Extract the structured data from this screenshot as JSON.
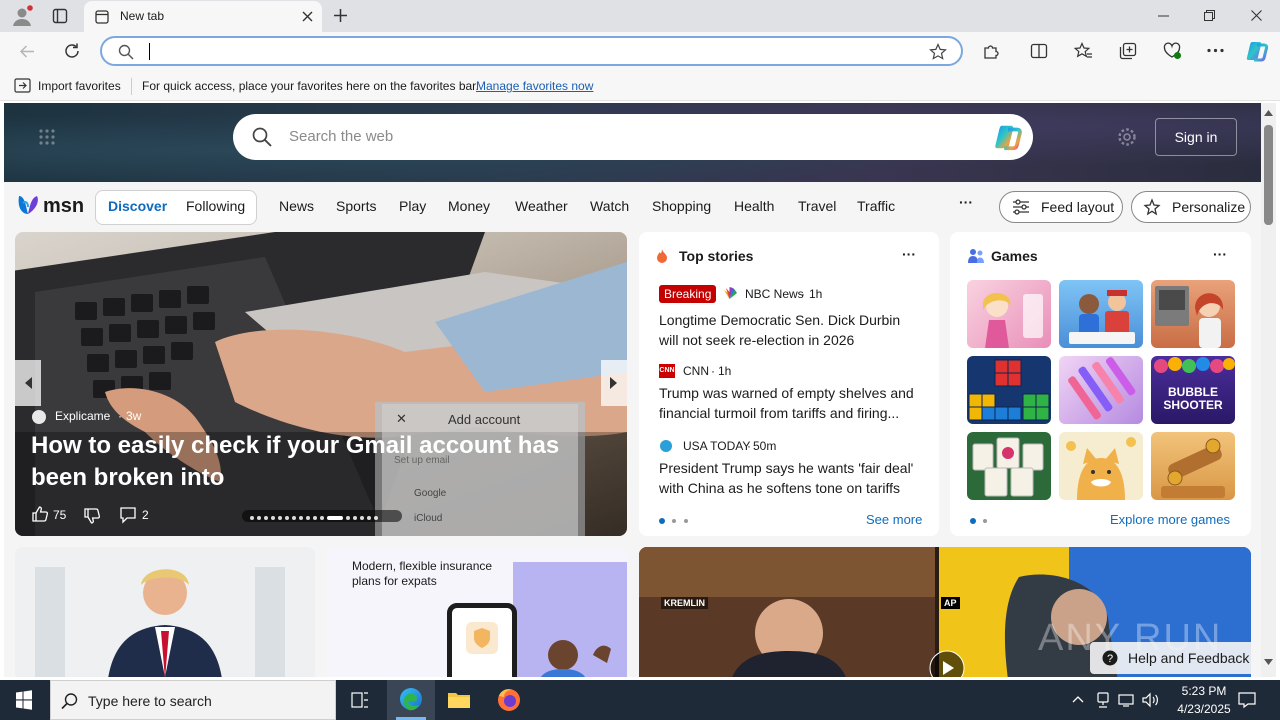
{
  "browser": {
    "tab_title": "New tab",
    "favorites_bar": {
      "import_label": "Import favorites",
      "hint": "For quick access, place your favorites here on the favorites bar.",
      "manage_link": "Manage favorites now"
    }
  },
  "msn": {
    "search_placeholder": "Search the web",
    "sign_in": "Sign in",
    "logo_text": "msn",
    "tabs": [
      "Discover",
      "Following"
    ],
    "nav": [
      "News",
      "Sports",
      "Play",
      "Money",
      "Weather",
      "Watch",
      "Shopping",
      "Health",
      "Travel",
      "Traffic"
    ],
    "more": "···",
    "feed_layout": "Feed layout",
    "personalize": "Personalize"
  },
  "carousel": {
    "source": "Explicame",
    "age": "3w",
    "title": "How to easily check if your Gmail account has been broken into",
    "likes": "75",
    "comments": "2",
    "overlay_title": "Add account",
    "overlay_close": "✕",
    "overlay_sub": "Set up email",
    "overlay_google": "Google",
    "overlay_icloud": "iCloud"
  },
  "top_stories": {
    "header": "Top stories",
    "more": "···",
    "breaking": "Breaking",
    "stories": [
      {
        "source": "NBC News",
        "age": "1h",
        "title": "Longtime Democratic Sen. Dick Durbin will not seek re-election in 2026"
      },
      {
        "source": "CNN",
        "age": "1h",
        "title": "Trump was warned of empty shelves and financial turmoil from tariffs and firing..."
      },
      {
        "source": "USA TODAY",
        "age": "50m",
        "title": "President Trump says he wants 'fair deal' with China as he softens tone on tariffs"
      }
    ],
    "see_more": "See more",
    "cnn_logo": "CNN"
  },
  "games": {
    "header": "Games",
    "more": "···",
    "explore": "Explore more games",
    "bubble_label": "BUBBLE SHOOTER",
    "tiles": [
      {
        "name": "dress-up-girl",
        "color": "#f3b7d0"
      },
      {
        "name": "hotel-manager",
        "color": "#5aa8e8"
      },
      {
        "name": "cooking-girl",
        "color": "#e8835a"
      },
      {
        "name": "block-puzzle",
        "color": "#1e4fa8"
      },
      {
        "name": "makeup-brushes",
        "color": "#c9a0e8"
      },
      {
        "name": "bubble-shooter",
        "color": "#3b2a8a"
      },
      {
        "name": "mahjong",
        "color": "#2f6b3a"
      },
      {
        "name": "cat-match",
        "color": "#f4e7c8"
      },
      {
        "name": "wood-nuts",
        "color": "#e6b36a"
      }
    ]
  },
  "bottom_row": {
    "insurance_title": "Modern, flexible insurance plans for expats",
    "kremlin_tag": "KREMLIN",
    "ap_tag": "AP",
    "watermark": "ANY RUN",
    "help": "Help and Feedback"
  },
  "taskbar": {
    "search_placeholder": "Type here to search",
    "time": "5:23 PM",
    "date": "4/23/2025"
  }
}
